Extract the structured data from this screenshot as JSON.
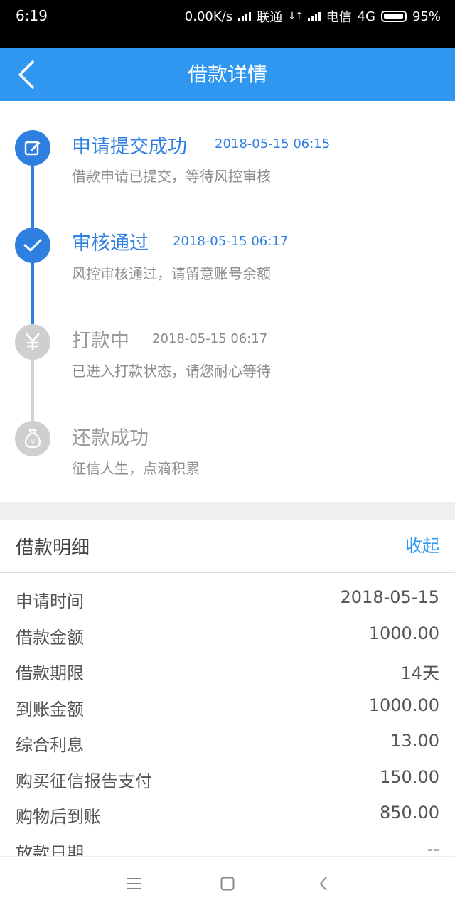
{
  "status_bar": {
    "time": "6:19",
    "speed": "0.00K/s",
    "carrier1": "联通",
    "carrier2": "电信",
    "network": "4G",
    "battery": "95%"
  },
  "header": {
    "title": "借款详情",
    "bg_color": "#2f97f0"
  },
  "timeline": [
    {
      "title": "申请提交成功",
      "time": "2018-05-15 06:15",
      "desc": "借款申请已提交，等待风控审核",
      "icon": "edit-icon",
      "state": "done"
    },
    {
      "title": "审核通过",
      "time": "2018-05-15 06:17",
      "desc": "风控审核通过，请留意账号余额",
      "icon": "check-icon",
      "state": "done"
    },
    {
      "title": "打款中",
      "time": "2018-05-15 06:17",
      "desc": "已进入打款状态，请您耐心等待",
      "icon": "yen-icon",
      "state": "pending"
    },
    {
      "title": "还款成功",
      "time": "",
      "desc": "征信人生，点滴积累",
      "icon": "money-bag-icon",
      "state": "pending"
    }
  ],
  "detail": {
    "title": "借款明细",
    "collapse_label": "收起",
    "rows": [
      {
        "label": "申请时间",
        "value": "2018-05-15"
      },
      {
        "label": "借款金额",
        "value": "1000.00"
      },
      {
        "label": "借款期限",
        "value": "14天"
      },
      {
        "label": "到账金额",
        "value": "1000.00"
      },
      {
        "label": "综合利息",
        "value": "13.00"
      },
      {
        "label": "购买征信报告支付",
        "value": "150.00"
      },
      {
        "label": "购物后到账",
        "value": "850.00"
      },
      {
        "label": "放款日期",
        "value": "--"
      }
    ]
  },
  "colors": {
    "accent": "#2f7fe0",
    "inactive": "#cfcfcf"
  }
}
